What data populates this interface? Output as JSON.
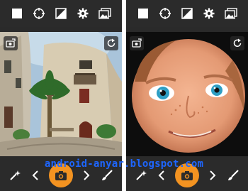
{
  "watermark": {
    "text": "android-anyar.blogspot.com"
  },
  "colors": {
    "toolbar_bg": "#2b2b2b",
    "shutter_accent": "#f39321",
    "watermark": "#1e66ff"
  },
  "toolbar_icons": [
    "white-square-icon",
    "target-icon",
    "contrast-icon",
    "gear-icon",
    "gallery-icon"
  ],
  "overlay_icons": [
    "flip-camera-icon",
    "refresh-icon"
  ],
  "bottom_icons": [
    "magic-wand-icon",
    "chevron-left-icon",
    "camera-icon",
    "chevron-right-icon",
    "brush-icon"
  ],
  "screens": [
    {
      "content": "fisheye-street-photo"
    },
    {
      "content": "fisheye-face-photo"
    }
  ]
}
